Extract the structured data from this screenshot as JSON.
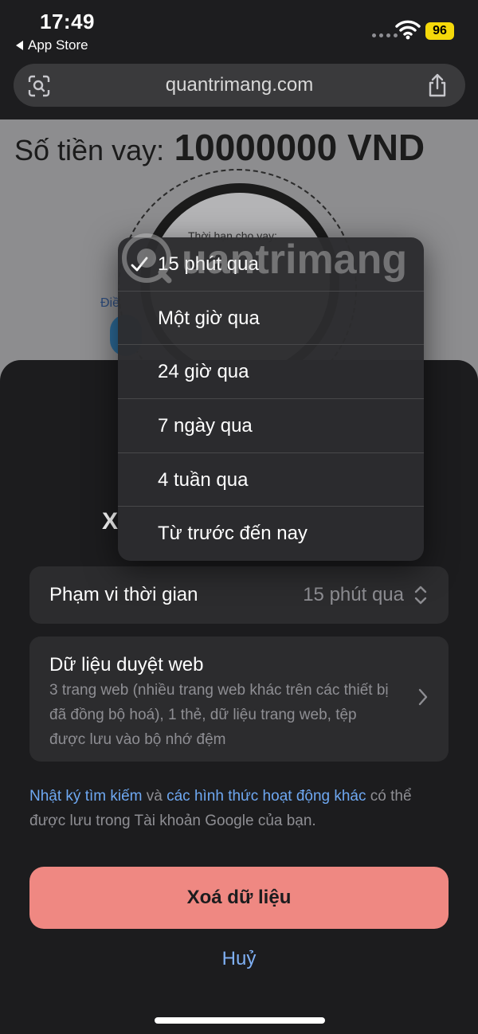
{
  "status_bar": {
    "time": "17:49",
    "back_app": "App Store",
    "battery": "96",
    "battery_color": "#f5d90a"
  },
  "browser": {
    "url": "quantrimang.com",
    "left_icon": "scan-icon",
    "right_icon": "share-icon"
  },
  "webpage": {
    "loan_label": "Số tiền vay:",
    "loan_amount": "10000000 VND",
    "dial_caption": "Thời hạn cho vay:",
    "side_link": "Điề"
  },
  "sheet": {
    "title_peek": "X",
    "time_range": {
      "label": "Phạm vi thời gian",
      "value": "15 phút qua"
    },
    "browsing_data": {
      "title": "Dữ liệu duyệt web",
      "description": "3 trang web (nhiều trang web khác trên các thiết bị đã đồng bộ hoá), 1 thẻ, dữ liệu trang web, tệp được lưu vào bộ nhớ đệm"
    },
    "google_note": {
      "link1": "Nhật ký tìm kiếm",
      "and": " và ",
      "link2": "các hình thức hoạt động khác",
      "rest": " có thể được lưu trong Tài khoản Google của bạn."
    },
    "delete_label": "Xoá dữ liệu",
    "cancel_label": "Huỷ",
    "accent_color": "#ef8882",
    "link_color": "#6ea8f2"
  },
  "menu": {
    "items": [
      {
        "label": "15 phút qua",
        "selected": true
      },
      {
        "label": "Một giờ qua",
        "selected": false
      },
      {
        "label": "24 giờ qua",
        "selected": false
      },
      {
        "label": "7 ngày qua",
        "selected": false
      },
      {
        "label": "4 tuần qua",
        "selected": false
      },
      {
        "label": "Từ trước đến nay",
        "selected": false
      }
    ]
  },
  "watermark": {
    "text": "uantrimang"
  }
}
